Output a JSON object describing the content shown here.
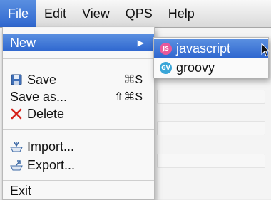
{
  "menubar": {
    "items": [
      {
        "label": "File"
      },
      {
        "label": "Edit"
      },
      {
        "label": "View"
      },
      {
        "label": "QPS"
      },
      {
        "label": "Help"
      }
    ]
  },
  "file_menu": {
    "new_label": "New",
    "save_label": "Save",
    "save_shortcut": "⌘S",
    "save_as_label": "Save as...",
    "save_as_shortcut": "⇧⌘S",
    "delete_label": "Delete",
    "import_label": "Import...",
    "export_label": "Export...",
    "exit_label": "Exit"
  },
  "new_submenu": {
    "items": [
      {
        "label": "javascript",
        "badge": "JS",
        "color": "#e8589a"
      },
      {
        "label": "groovy",
        "badge": "GV",
        "color": "#3aa6d8"
      }
    ]
  },
  "colors": {
    "highlight": "#3a74d6"
  },
  "icons": {
    "save": "floppy-disk-icon",
    "delete": "red-x-icon",
    "import": "import-tray-icon",
    "export": "export-tray-icon",
    "submenu": "triangle-right-icon",
    "cursor": "mouse-pointer-icon"
  }
}
